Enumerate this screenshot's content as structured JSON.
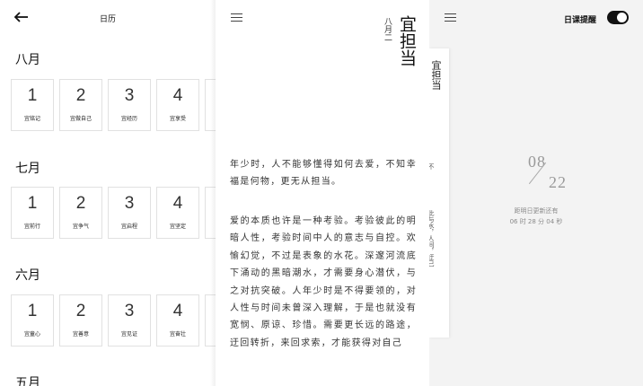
{
  "calendar": {
    "title": "日历",
    "months": [
      {
        "label": "八月",
        "days": [
          {
            "num": "1",
            "tag": "宜铭记"
          },
          {
            "num": "2",
            "tag": "宜做自己"
          },
          {
            "num": "3",
            "tag": "宜经历"
          },
          {
            "num": "4",
            "tag": "宜享受"
          }
        ]
      },
      {
        "label": "七月",
        "days": [
          {
            "num": "1",
            "tag": "宜前行"
          },
          {
            "num": "2",
            "tag": "宜争气"
          },
          {
            "num": "3",
            "tag": "宜启程"
          },
          {
            "num": "4",
            "tag": "宜坚定"
          }
        ]
      },
      {
        "label": "六月",
        "days": [
          {
            "num": "1",
            "tag": "宜童心"
          },
          {
            "num": "2",
            "tag": "宜善意"
          },
          {
            "num": "3",
            "tag": "宜见证"
          },
          {
            "num": "4",
            "tag": "宜奋壮"
          }
        ]
      },
      {
        "label": "五月"
      }
    ]
  },
  "article": {
    "date_vertical": "八月二",
    "heading_vertical": "宜担当",
    "paragraphs": [
      "年少时，人不能够懂得如何去爱，不知幸福是何物，更无从担当。",
      "爱的本质也许是一种考验。考验彼此的明暗人性，考验时间中人的意志与自控。欢愉幻觉，不过是表象的水花。深邃河流底下涌动的黑暗潮水，才需要身心潜伏，与之对抗突破。人年少时是不得要领的，对人性与时间未曾深入理解，于是也就没有宽悯、原谅、珍惜。需要更长远的路途，迂回转折，来回求索，才能获得对自己"
    ]
  },
  "reminder": {
    "label": "日课提醒",
    "toggle_on": true,
    "date_month": "08",
    "date_day": "22",
    "update_text": "距明日更新还有",
    "countdown": "06 时 28 分 04 秒",
    "strip_heading": "宜担当",
    "strip_snippet": "不",
    "strip_snippet2": "此与水，人间，迂己"
  },
  "colors": {
    "background_dark_panel": "#f3f3f3",
    "toggle": "#111111"
  }
}
